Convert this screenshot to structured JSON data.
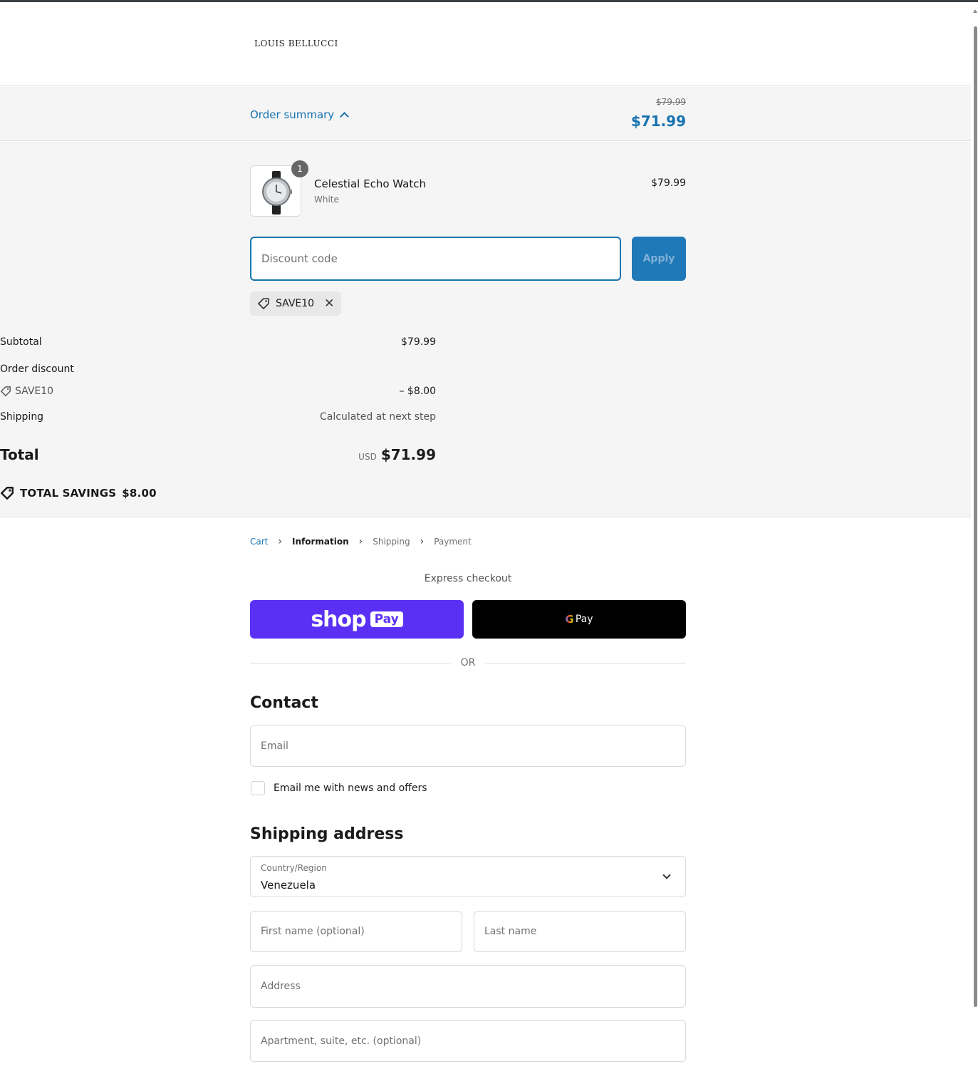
{
  "brand": {
    "logo_text": "LOUIS BELLUCCI"
  },
  "summary_bar": {
    "toggle_label": "Order summary",
    "original_price": "$79.99",
    "current_price": "$71.99"
  },
  "product": {
    "name": "Celestial Echo Watch",
    "variant": "White",
    "price": "$79.99",
    "quantity": "1"
  },
  "discount": {
    "placeholder": "Discount code",
    "apply_label": "Apply",
    "applied_code": "SAVE10"
  },
  "totals": {
    "subtotal_label": "Subtotal",
    "subtotal_value": "$79.99",
    "discount_label": "Order discount",
    "discount_code": "SAVE10",
    "discount_value": "– $8.00",
    "shipping_label": "Shipping",
    "shipping_value": "Calculated at next step",
    "total_label": "Total",
    "currency": "USD",
    "total_value": "$71.99",
    "savings_label": "TOTAL SAVINGS",
    "savings_value": "$8.00"
  },
  "breadcrumb": {
    "cart": "Cart",
    "information": "Information",
    "shipping": "Shipping",
    "payment": "Payment"
  },
  "express": {
    "label": "Express checkout",
    "shop_word": "shop",
    "shop_pay": "Pay",
    "gpay_g": "G",
    "gpay_pay": "Pay",
    "or_text": "OR"
  },
  "contact": {
    "title": "Contact",
    "email_placeholder": "Email",
    "newsletter_label": "Email me with news and offers"
  },
  "shipping_address": {
    "title": "Shipping address",
    "country_label": "Country/Region",
    "country_value": "Venezuela",
    "first_name_placeholder": "First name (optional)",
    "last_name_placeholder": "Last name",
    "address_placeholder": "Address",
    "apartment_placeholder": "Apartment, suite, etc. (optional)"
  },
  "colors": {
    "accent": "#1773b0",
    "shop_pay": "#5a31f4",
    "gpay": "#000000",
    "panel_bg": "#f5f5f5"
  }
}
